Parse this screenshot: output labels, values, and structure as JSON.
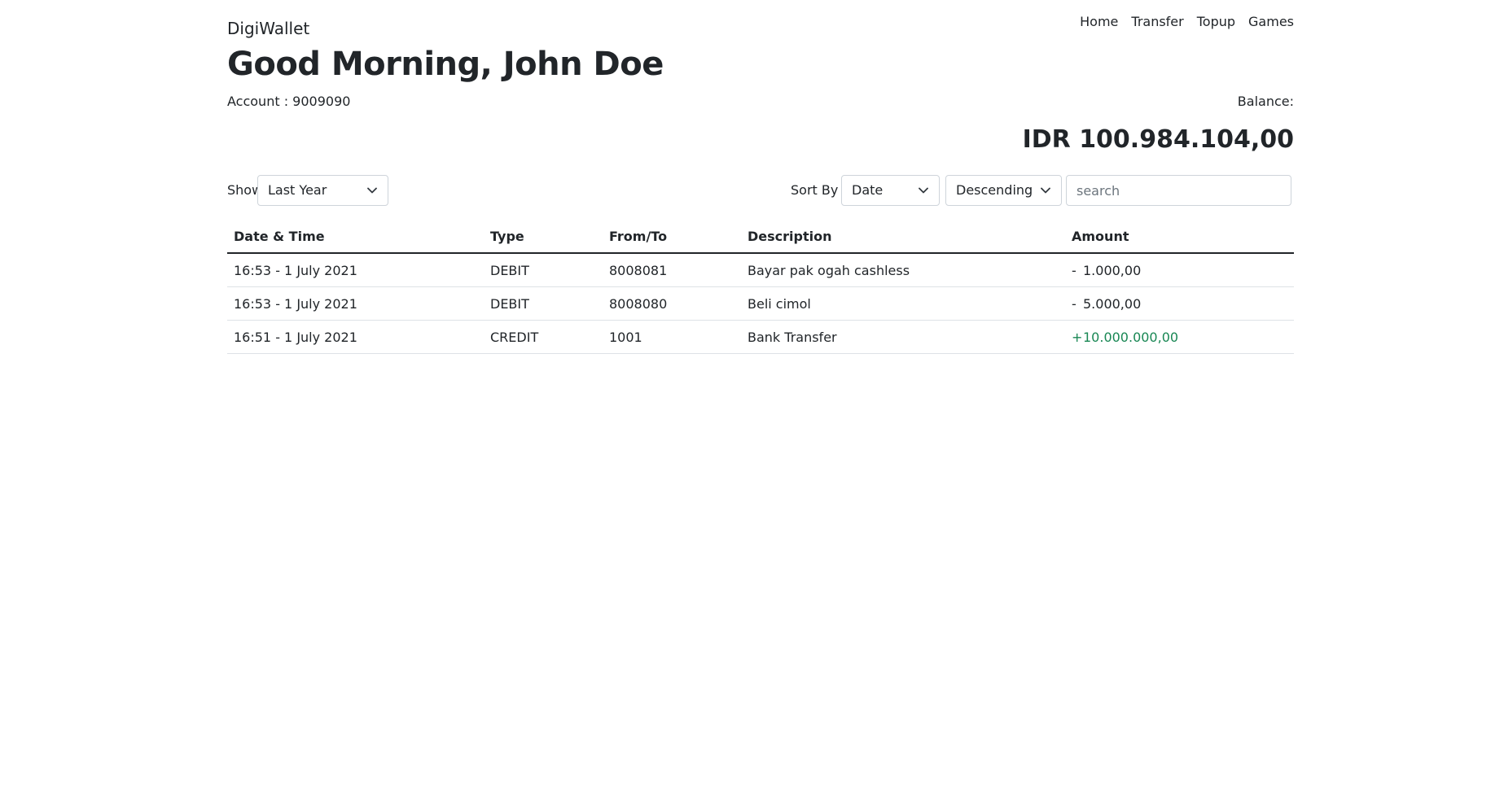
{
  "header": {
    "brand": "DigiWallet",
    "nav": [
      {
        "label": "Home"
      },
      {
        "label": "Transfer"
      },
      {
        "label": "Topup"
      },
      {
        "label": "Games"
      }
    ],
    "greeting": "Good Morning, John Doe",
    "account": "Account : 9009090",
    "balance_label": "Balance:",
    "balance_value": "IDR 100.984.104,00"
  },
  "filters": {
    "show_label": "Show",
    "show_value": "Last Year",
    "sort_label": "Sort By",
    "sort_value": "Date",
    "order_value": "Descending",
    "search_placeholder": "search"
  },
  "table": {
    "columns": [
      "Date & Time",
      "Type",
      "From/To",
      "Description",
      "Amount"
    ],
    "rows": [
      {
        "datetime": "16:53 - 1 July 2021",
        "type": "DEBIT",
        "from_to": "8008081",
        "description": "Bayar pak ogah cashless",
        "sign": "-",
        "amount": "1.000,00"
      },
      {
        "datetime": "16:53 - 1 July 2021",
        "type": "DEBIT",
        "from_to": "8008080",
        "description": "Beli cimol",
        "sign": "-",
        "amount": "5.000,00"
      },
      {
        "datetime": "16:51 - 1 July 2021",
        "type": "CREDIT",
        "from_to": "1001",
        "description": "Bank Transfer",
        "sign": "+",
        "amount": "10.000.000,00"
      }
    ]
  },
  "colors": {
    "credit": "#198754",
    "text": "#212529"
  },
  "icons": {
    "select_caret": "chevron-down-icon"
  }
}
